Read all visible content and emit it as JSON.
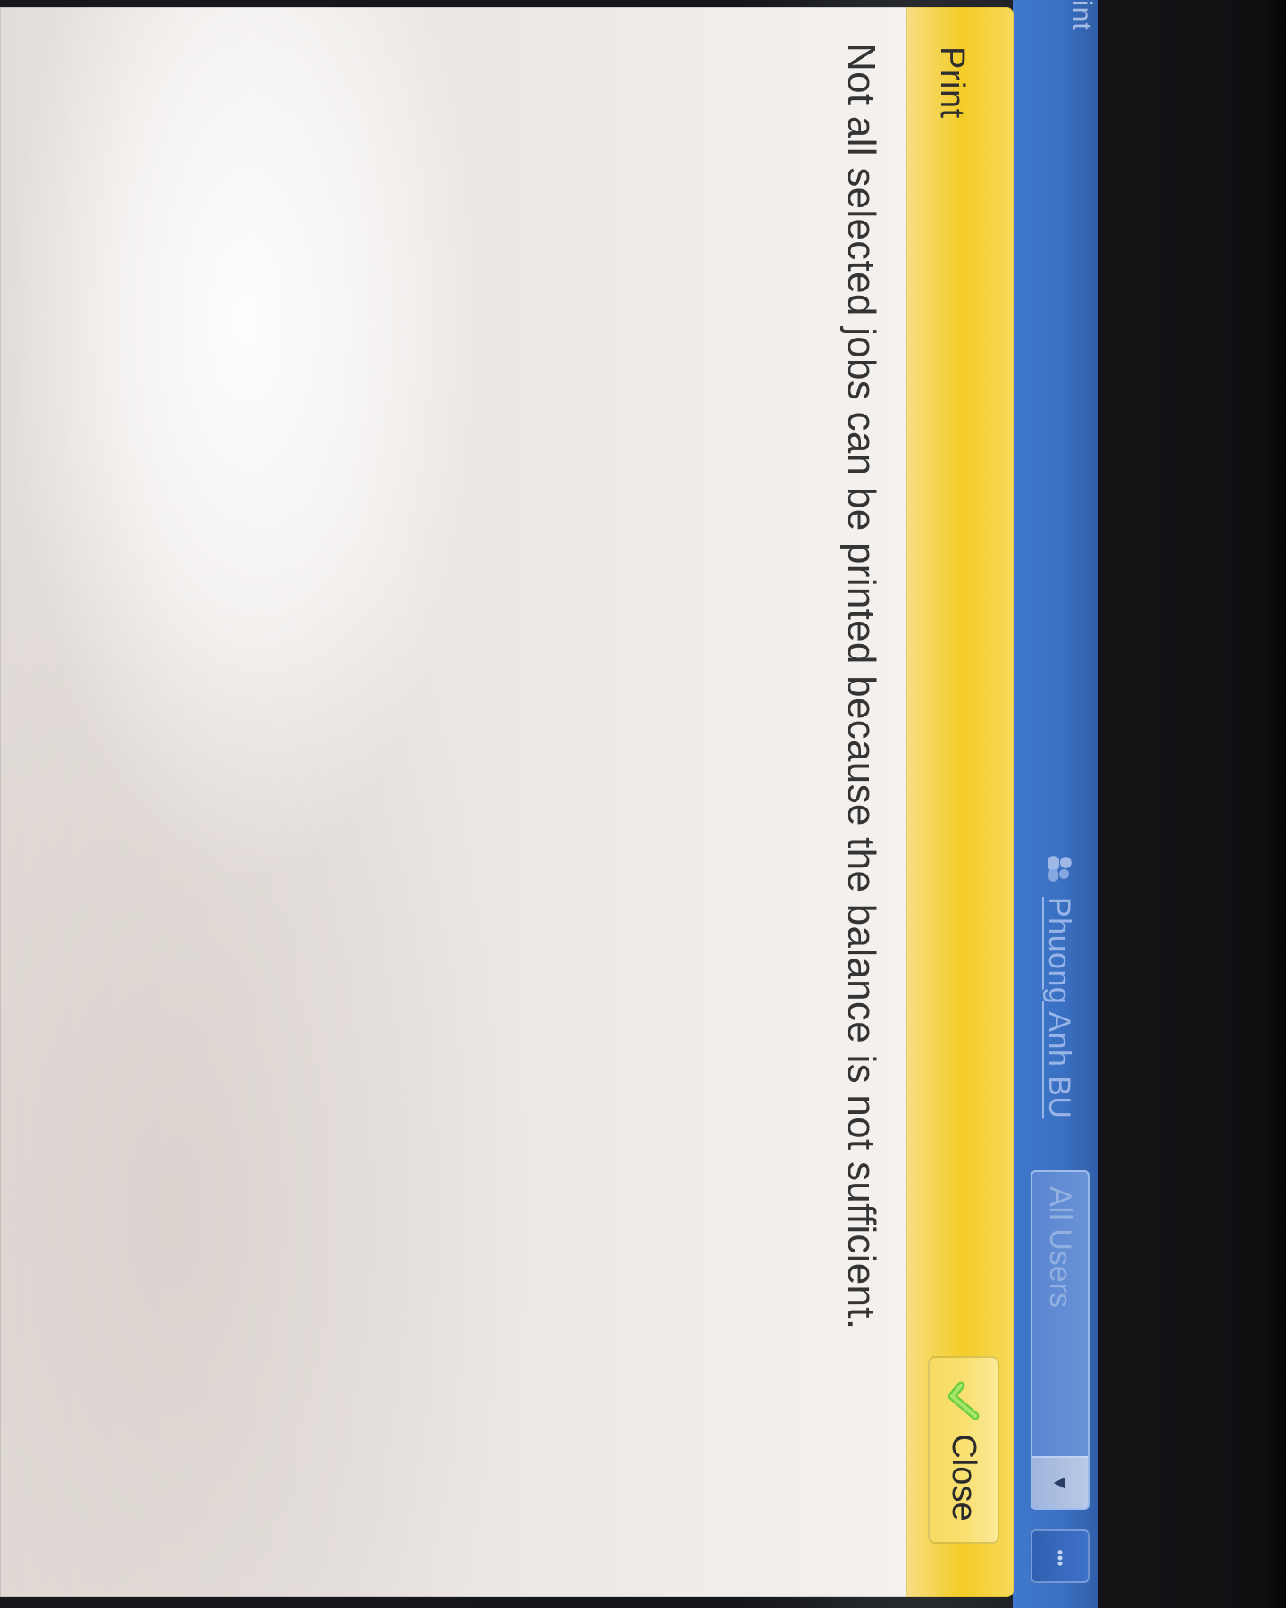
{
  "header": {
    "app_title_fragment": "int",
    "user_name": "Phuong Anh BU",
    "user_select_value": "All Users"
  },
  "dialog": {
    "title": "Print",
    "close_label": "Close",
    "message": "Not all selected jobs can be printed because the balance is not sufficient."
  },
  "icons": {
    "user_icon": "user-icon",
    "dropdown_icon": "chevron-down-icon",
    "close_icon": "check-icon"
  },
  "colors": {
    "header_blue": "#3f78cc",
    "dialog_yellow": "#f3cc26",
    "dialog_body": "#ece8e5",
    "text_dark": "#343434"
  }
}
